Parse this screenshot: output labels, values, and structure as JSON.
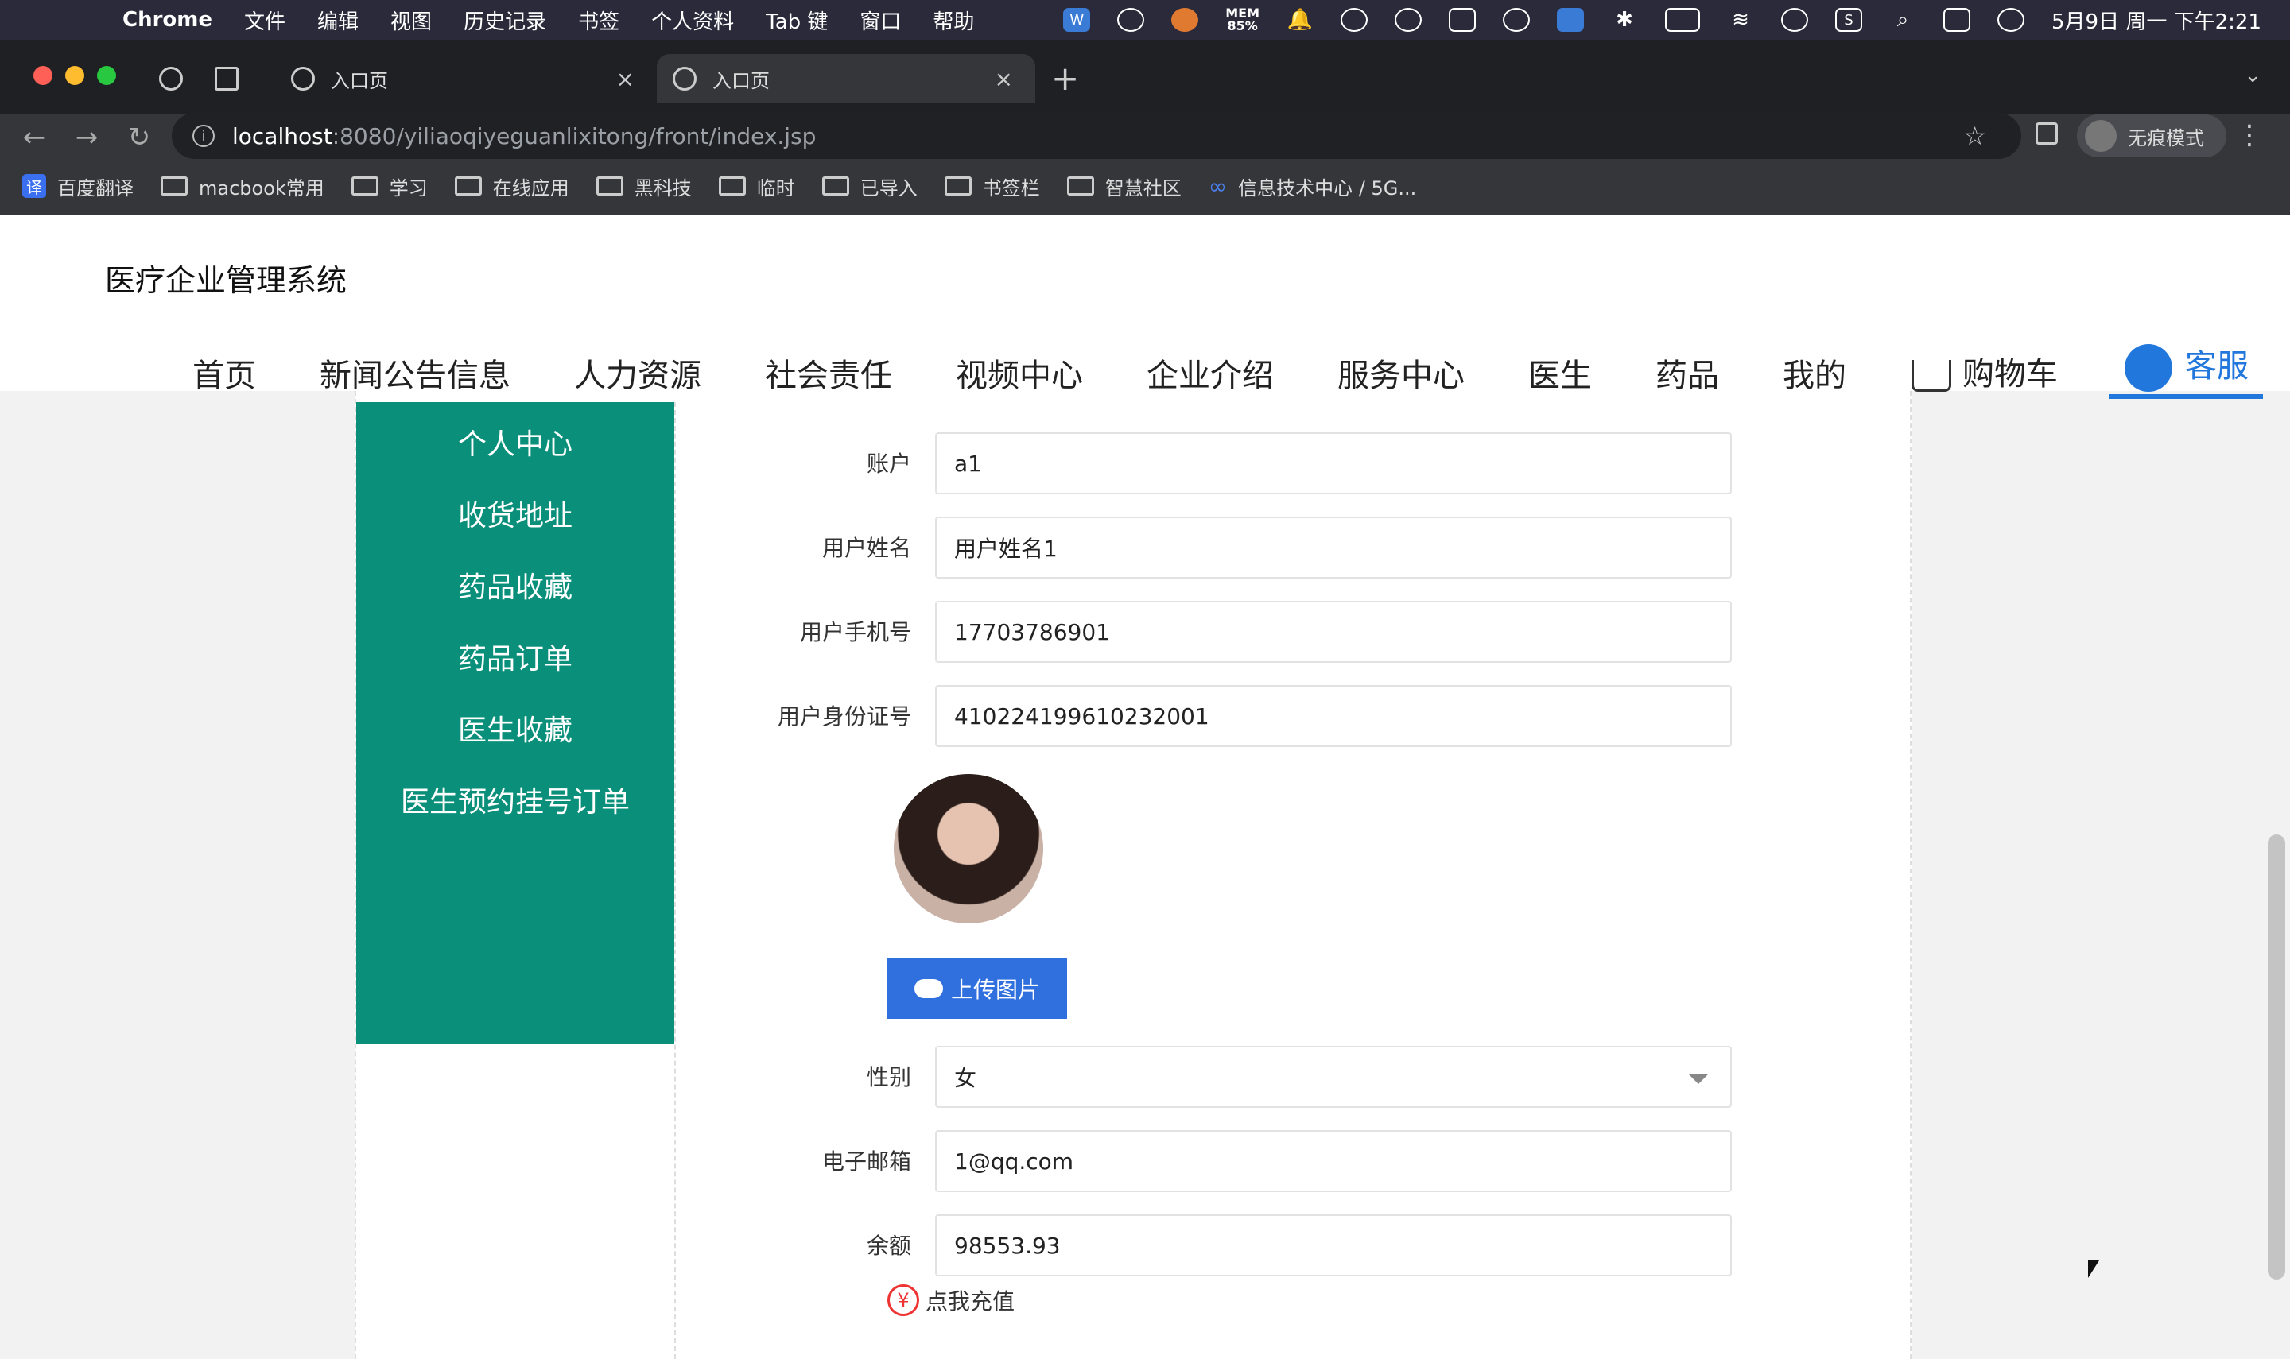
{
  "menubar": {
    "app": "Chrome",
    "items": [
      "文件",
      "编辑",
      "视图",
      "历史记录",
      "书签",
      "个人资料",
      "Tab 键",
      "窗口",
      "帮助"
    ],
    "mem": "MEM\n85%",
    "datetime": "5月9日 周一 下午2:21"
  },
  "browser": {
    "tabs": [
      {
        "label": "入口页"
      },
      {
        "label": "入口页"
      }
    ],
    "url_host": "localhost",
    "url_path": ":8080/yiliaoqiyeguanlixitong/front/index.jsp",
    "incognito_label": "无痕模式",
    "bookmarks": [
      "百度翻译",
      "macbook常用",
      "学习",
      "在线应用",
      "黑科技",
      "临时",
      "已导入",
      "书签栏",
      "智慧社区",
      "信息技术中心 / 5G..."
    ],
    "bookmark_translate_glyph": "译"
  },
  "site": {
    "title": "医疗企业管理系统",
    "nav": [
      "首页",
      "新闻公告信息",
      "人力资源",
      "社会责任",
      "视频中心",
      "企业介绍",
      "服务中心",
      "医生",
      "药品",
      "我的"
    ],
    "cart": "购物车",
    "kefu": "客服"
  },
  "sidebar": {
    "items": [
      "个人中心",
      "收货地址",
      "药品收藏",
      "药品订单",
      "医生收藏",
      "医生预约挂号订单"
    ]
  },
  "form": {
    "account_label": "账户",
    "account_value": "a1",
    "name_label": "用户姓名",
    "name_value": "用户姓名1",
    "phone_label": "用户手机号",
    "phone_value": "17703786901",
    "idcard_label": "用户身份证号",
    "idcard_value": "410224199610232001",
    "upload_label": "上传图片",
    "gender_label": "性别",
    "gender_value": "女",
    "email_label": "电子邮箱",
    "email_value": "1@qq.com",
    "balance_label": "余额",
    "balance_value": "98553.93",
    "recharge_label": "点我充值",
    "yen_glyph": "¥"
  }
}
